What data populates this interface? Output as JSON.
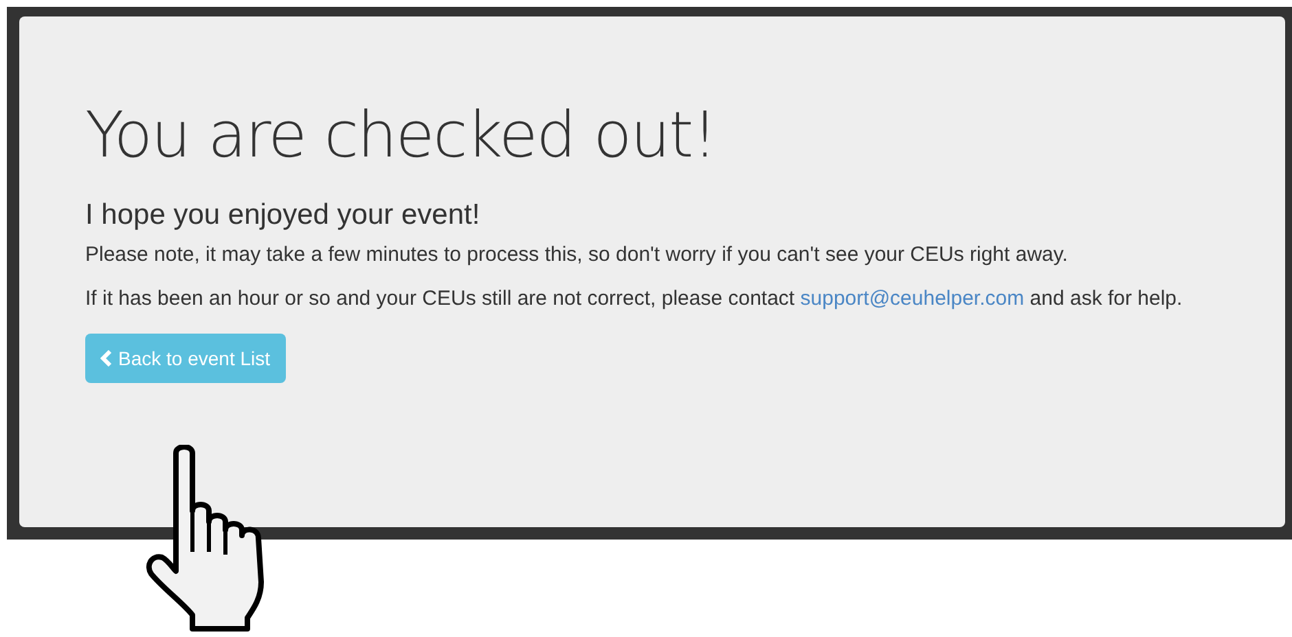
{
  "heading": "You are checked out!",
  "subheading": "I hope you enjoyed your event!",
  "note": "Please note, it may take a few minutes to process this, so don't worry if you can't see your CEUs right away.",
  "help": {
    "text": "If it has been an hour or so and your CEUs still are not correct, please contact",
    "link": "support@ceuhelper.com",
    "after": "and ask for help."
  },
  "button": {
    "label": "Back to event List"
  }
}
